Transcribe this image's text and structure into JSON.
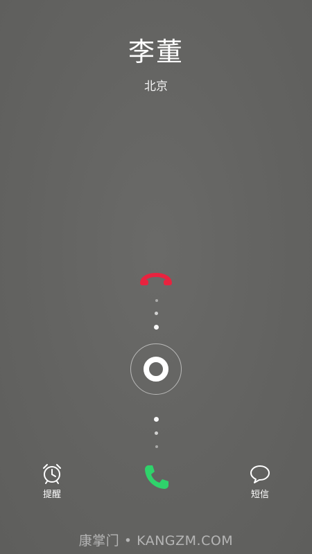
{
  "call": {
    "caller_name": "李董",
    "location": "北京"
  },
  "actions": {
    "remind_label": "提醒",
    "message_label": "短信"
  },
  "icons": {
    "decline": "decline-call-icon",
    "accept": "accept-call-icon",
    "remind": "alarm-clock-icon",
    "message": "speech-bubble-icon"
  },
  "colors": {
    "decline": "#e8233f",
    "accept": "#2fd36b",
    "background": "#636361"
  },
  "watermark": {
    "text": "康掌门 • KANGZM.COM"
  }
}
